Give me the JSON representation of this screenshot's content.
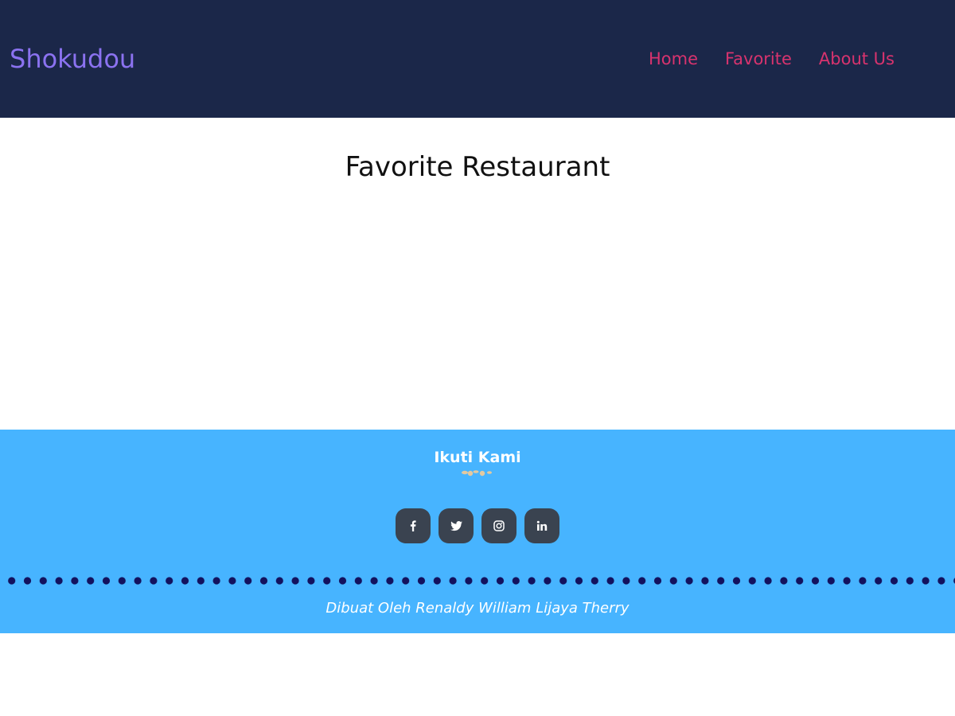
{
  "header": {
    "brand": "Shokudou",
    "nav": [
      "Home",
      "Favorite",
      "About Us"
    ]
  },
  "main": {
    "title": "Favorite Restaurant"
  },
  "footer": {
    "heading": "Ikuti Kami",
    "socials": [
      "facebook-icon",
      "twitter-icon",
      "instagram-icon",
      "linkedin-icon"
    ],
    "credit": "Dibuat Oleh Renaldy William Lijaya Therry"
  },
  "colors": {
    "header_bg": "#1b2749",
    "brand": "#8b72f0",
    "nav_link": "#d8336e",
    "footer_bg": "#47b4ff",
    "social_bg": "#3a4350",
    "dots": "#13125e",
    "ornament": "#e3c9a0"
  }
}
